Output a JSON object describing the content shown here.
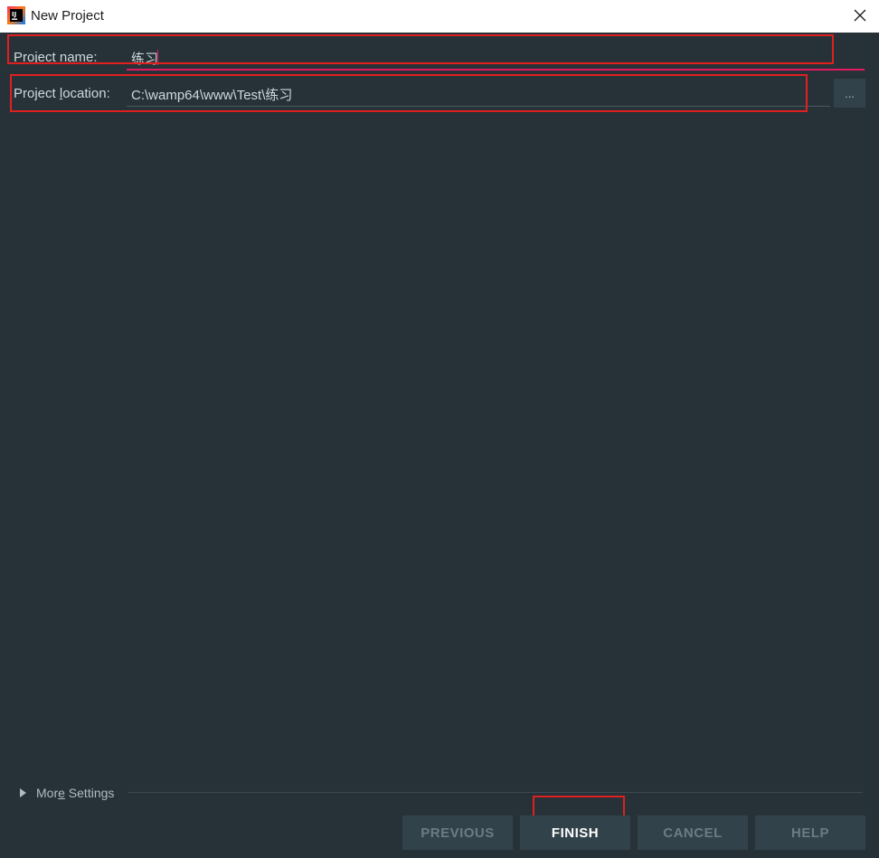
{
  "window": {
    "title": "New Project",
    "icon": "intellij-app-icon",
    "close_icon": "close-icon"
  },
  "form": {
    "project_name": {
      "label_prefix": "Project name:",
      "value": "练习"
    },
    "project_location": {
      "label_before": "Project ",
      "label_mnemonic": "l",
      "label_after": "ocation:",
      "value": "C:\\wamp64\\www\\Test\\练习",
      "browse_label": "..."
    }
  },
  "more_settings": {
    "label_before": "Mor",
    "label_mnemonic": "e",
    "label_after": " Settings",
    "expanded": false
  },
  "buttons": {
    "previous": "PREVIOUS",
    "finish": "FINISH",
    "cancel": "CANCEL",
    "help": "HELP"
  },
  "colors": {
    "background": "#263238",
    "accent": "#e5195e",
    "annotation": "#e02020"
  }
}
